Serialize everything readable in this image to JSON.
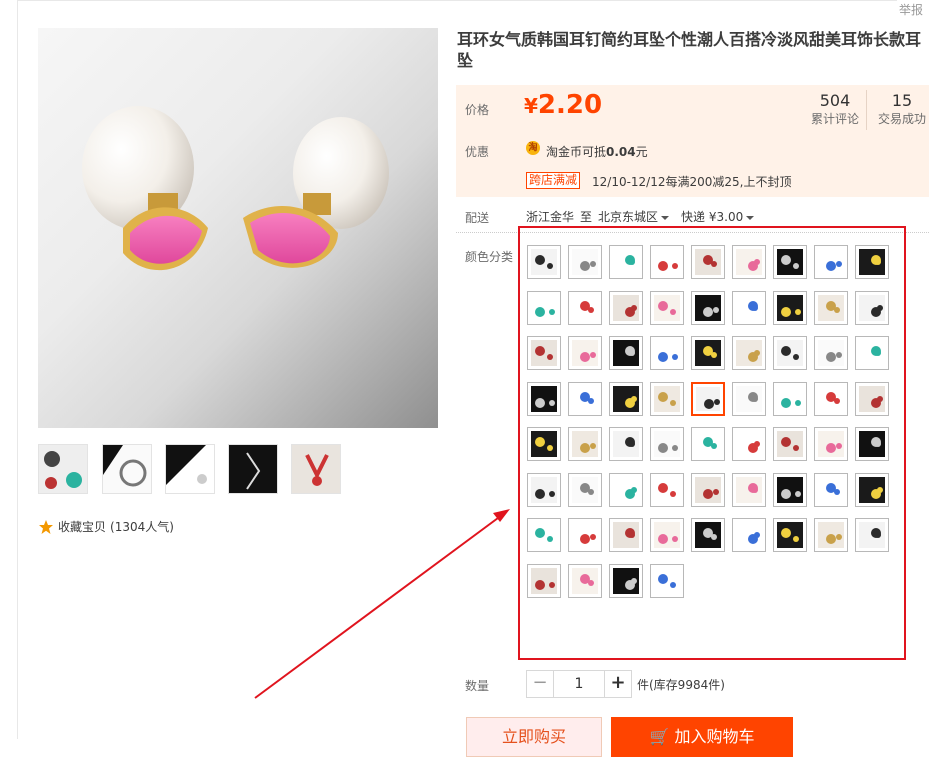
{
  "report_link": "举报",
  "product": {
    "title": "耳环女气质韩国耳钉简约耳坠个性潮人百搭冷淡风甜美耳饰长款耳坠",
    "price_label": "价格",
    "currency": "¥",
    "price": "2.20",
    "reviews_count": "504",
    "reviews_label": "累计评论",
    "deals_count": "15",
    "deals_label": "交易成功",
    "promo_label": "优惠",
    "coin_icon_text": "淘",
    "coin_prefix": "淘金币可抵",
    "coin_amount": "0.04",
    "coin_suffix": "元",
    "shop_promo_tag": "跨店满减",
    "shop_promo_text": "12/10-12/12每满200减25,上不封顶"
  },
  "shipping": {
    "label": "配送",
    "from": "浙江金华",
    "to_word": "至",
    "destination": "北京东城区",
    "method": "快递 ¥3.00"
  },
  "sku": {
    "label": "颜色分类",
    "selected_index": 31,
    "count": 67
  },
  "quantity": {
    "label": "数量",
    "value": "1",
    "minus": "−",
    "plus": "+",
    "stock": "件(库存9984件)"
  },
  "favorite": {
    "text": "收藏宝贝",
    "popularity": "(1304人气)"
  },
  "buttons": {
    "buy_now": "立即购买",
    "add_to_cart": "加入购物车"
  },
  "thumbnails_count": 5,
  "colors": {
    "accent": "#ff4400",
    "price_bg": "#fff2e8",
    "annotation": "#e0141e"
  }
}
